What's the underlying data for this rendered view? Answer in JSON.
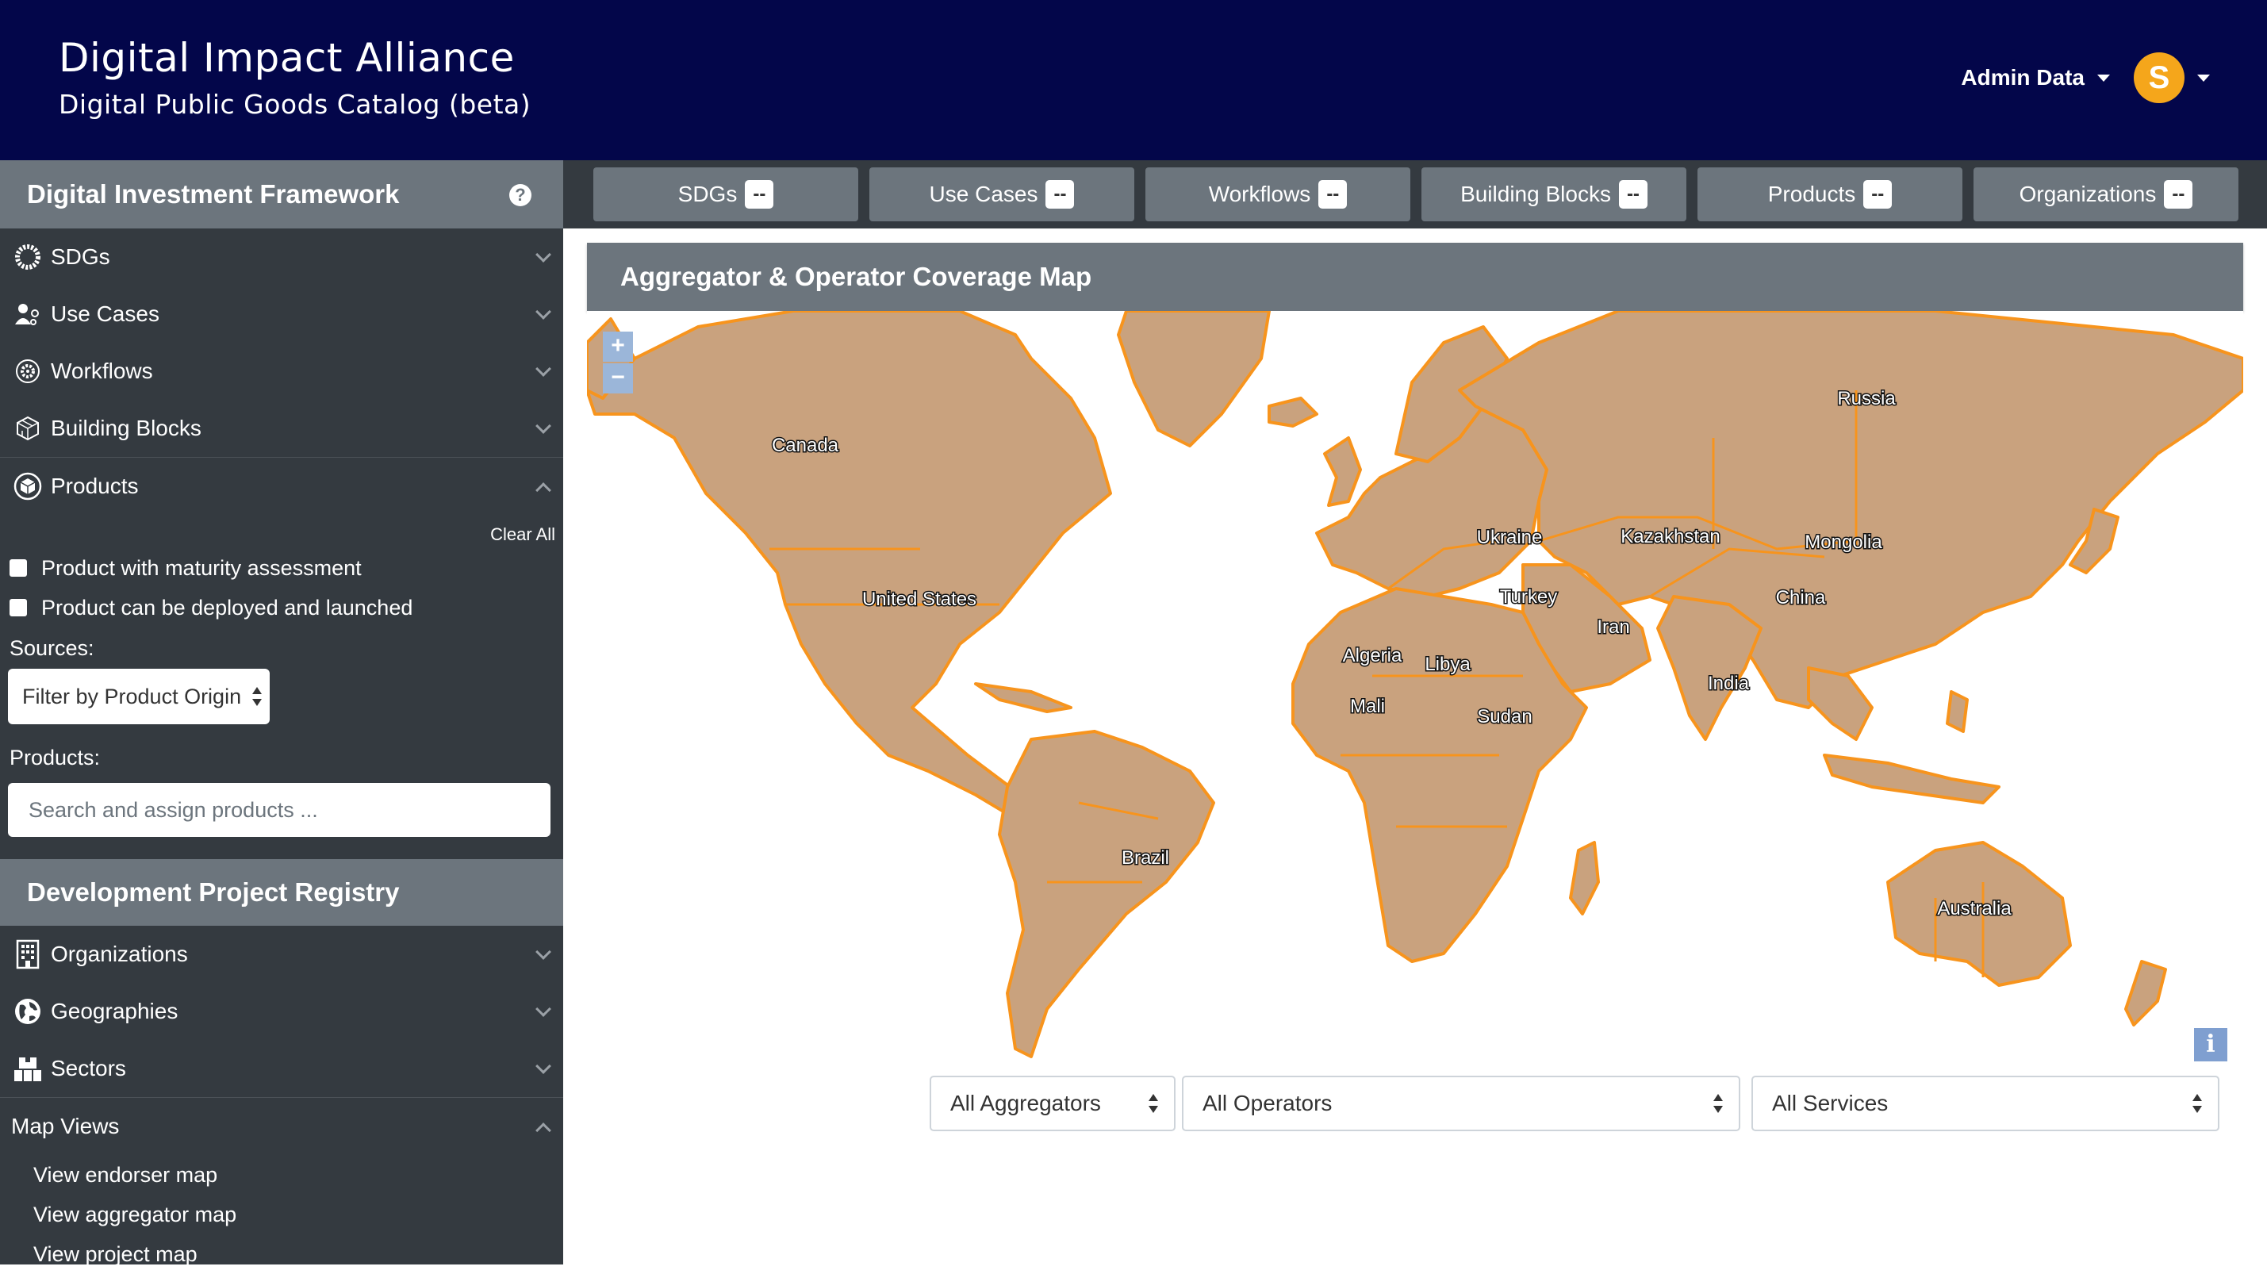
{
  "header": {
    "title": "Digital Impact Alliance",
    "subtitle": "Digital Public Goods Catalog (beta)",
    "user_name": "Admin Data",
    "avatar_letter": "S",
    "avatar_color": "#f5a61b",
    "background": "#03064a"
  },
  "sidebar": {
    "framework_title": "Digital Investment Framework",
    "framework_items": [
      {
        "label": "SDGs",
        "icon": "sdg-wheel-icon"
      },
      {
        "label": "Use Cases",
        "icon": "use-cases-icon"
      },
      {
        "label": "Workflows",
        "icon": "workflows-gear-icon"
      },
      {
        "label": "Building Blocks",
        "icon": "building-blocks-icon"
      },
      {
        "label": "Products",
        "icon": "products-box-icon"
      }
    ],
    "products_panel": {
      "clear_all": "Clear All",
      "checkbox_maturity": "Product with maturity assessment",
      "checkbox_deploy": "Product can be deployed and launched",
      "sources_label": "Sources:",
      "sources_select": "Filter by Product Origin",
      "products_label": "Products:",
      "products_placeholder": "Search and assign products ..."
    },
    "registry_title": "Development Project Registry",
    "registry_items": [
      {
        "label": "Organizations",
        "icon": "building-icon"
      },
      {
        "label": "Geographies",
        "icon": "globe-icon"
      },
      {
        "label": "Sectors",
        "icon": "sectors-icon"
      }
    ],
    "map_views": {
      "label": "Map Views",
      "links": [
        "View endorser map",
        "View aggregator map",
        "View project map"
      ]
    }
  },
  "tabs": [
    {
      "label": "SDGs",
      "count": "--"
    },
    {
      "label": "Use Cases",
      "count": "--"
    },
    {
      "label": "Workflows",
      "count": "--"
    },
    {
      "label": "Building Blocks",
      "count": "--"
    },
    {
      "label": "Products",
      "count": "--"
    },
    {
      "label": "Organizations",
      "count": "--"
    }
  ],
  "main": {
    "panel_title": "Aggregator & Operator Coverage Map",
    "zoom_in": "+",
    "zoom_out": "−",
    "info": "i",
    "land_color": "#c9a27e",
    "border_color": "#f7941d",
    "countries": [
      "Canada",
      "United States",
      "Brazil",
      "Russia",
      "Ukraine",
      "Kazakhstan",
      "Mongolia",
      "Turkey",
      "China",
      "Iran",
      "India",
      "Algeria",
      "Libya",
      "Mali",
      "Sudan",
      "Australia"
    ],
    "filters": {
      "aggregators": "All Aggregators",
      "operators": "All Operators",
      "services": "All Services"
    }
  }
}
